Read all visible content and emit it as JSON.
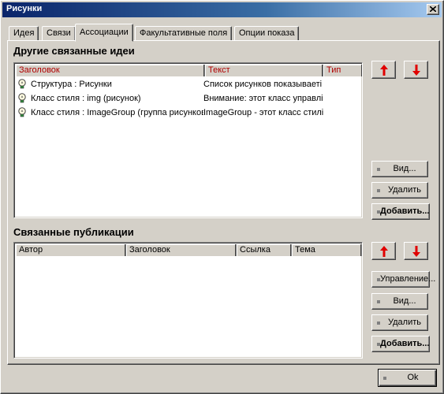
{
  "window": {
    "title": "Рисунки",
    "close_symbol": "✕"
  },
  "tabs": [
    {
      "label": "Идея",
      "active": false
    },
    {
      "label": "Связи",
      "active": false
    },
    {
      "label": "Ассоциации",
      "active": true
    },
    {
      "label": "Факультативные поля",
      "active": false
    },
    {
      "label": "Опции показа",
      "active": false
    }
  ],
  "related_ideas": {
    "title": "Другие связанные идеи",
    "columns": [
      "Заголовок",
      "Текст",
      "Тип"
    ],
    "rows": [
      {
        "title": "Структура : Рисунки",
        "text": "Список рисунков показываеті",
        "icon": "lightbulb-icon"
      },
      {
        "title": "Класс стиля : img (рисунок)",
        "text": "Внимание: этот класс управлі",
        "icon": "lightbulb-icon"
      },
      {
        "title": "Класс стиля : ImageGroup (группа рисунков)",
        "text": "ImageGroup - этот класс стилі",
        "icon": "lightbulb-icon"
      }
    ],
    "buttons": {
      "view": "Вид...",
      "delete": "Удалить",
      "add": "Добавить..."
    },
    "arrow_colors": {
      "up": "#e00000",
      "down": "#e00000"
    }
  },
  "related_publications": {
    "title": "Связанные публикации",
    "columns": [
      "Автор",
      "Заголовок",
      "Ссылка",
      "Тема"
    ],
    "rows": [],
    "buttons": {
      "manage": "Управление...",
      "view": "Вид...",
      "delete": "Удалить",
      "add": "Добавить..."
    }
  },
  "footer": {
    "ok": "Ok"
  }
}
